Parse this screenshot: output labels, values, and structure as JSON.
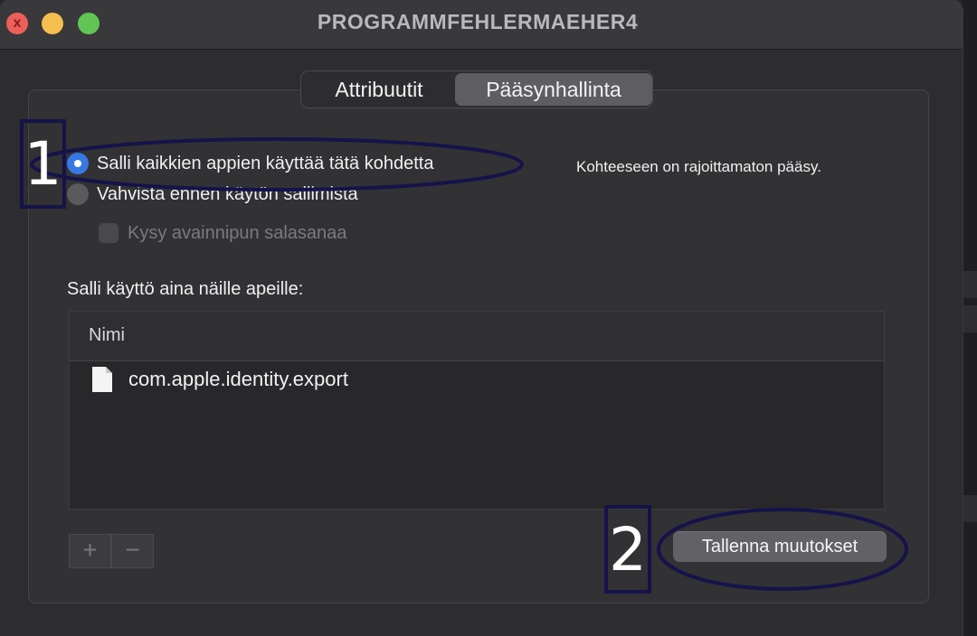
{
  "window": {
    "title": "PROGRAMMFEHLERMAEHER4",
    "close_glyph": "x"
  },
  "tabs": [
    {
      "label": "Attribuutit",
      "selected": false
    },
    {
      "label": "Pääsynhallinta",
      "selected": true
    }
  ],
  "access": {
    "option_allow_all": "Salli kaikkien appien käyttää tätä kohdetta",
    "option_confirm": "Vahvista ennen käytön sallimista",
    "checkbox_ask_password": "Kysy avainnipun salasanaa",
    "description": "Kohteeseen on rajoittamaton pääsy.",
    "selected_option": "allow_all"
  },
  "apps": {
    "heading": "Salli käyttö aina näille apeille:",
    "column_name": "Nimi",
    "rows": [
      {
        "name": "com.apple.identity.export",
        "icon": "document-icon"
      }
    ],
    "add_label": "+",
    "remove_label": "−"
  },
  "footer": {
    "save_label": "Tallenna muutokset"
  },
  "annotations": {
    "marker_1": "1",
    "marker_2": "2",
    "color": "#15134a"
  },
  "colors": {
    "accent": "#3778e4",
    "close": "#ec5f5b",
    "minimize": "#f4bf4f",
    "zoom": "#61c554"
  }
}
